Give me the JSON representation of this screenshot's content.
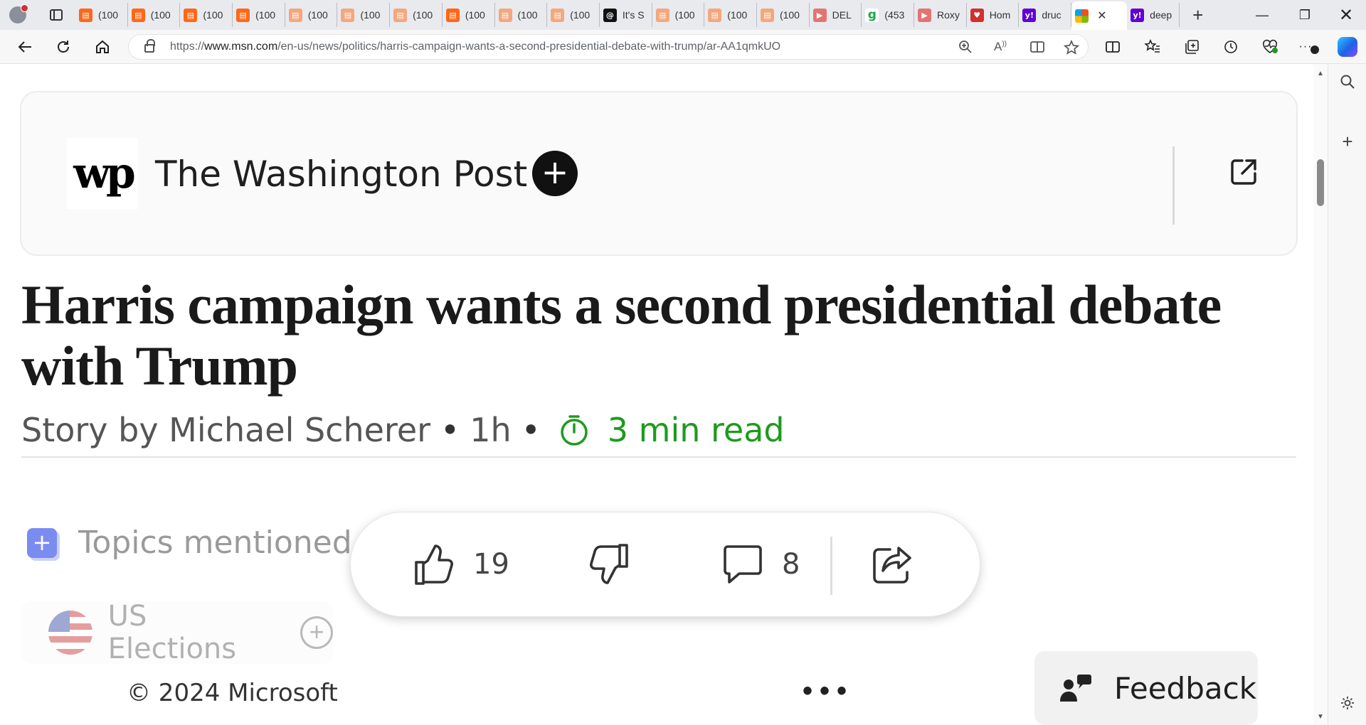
{
  "tabs": [
    {
      "label": "(100",
      "favicon": "substack-icon",
      "variant": "substack"
    },
    {
      "label": "(100",
      "favicon": "substack-icon",
      "variant": "substack"
    },
    {
      "label": "(100",
      "favicon": "substack-icon",
      "variant": "substack"
    },
    {
      "label": "(100",
      "favicon": "substack-icon",
      "variant": "substack"
    },
    {
      "label": "(100",
      "favicon": "substack-icon",
      "variant": "substack-faded"
    },
    {
      "label": "(100",
      "favicon": "substack-icon",
      "variant": "substack-faded"
    },
    {
      "label": "(100",
      "favicon": "substack-icon",
      "variant": "substack-faded"
    },
    {
      "label": "(100",
      "favicon": "substack-icon",
      "variant": "substack"
    },
    {
      "label": "(100",
      "favicon": "substack-icon",
      "variant": "substack-faded"
    },
    {
      "label": "(100",
      "favicon": "substack-icon",
      "variant": "substack-faded"
    },
    {
      "label": "It's S",
      "favicon": "threads-icon",
      "variant": "threads"
    },
    {
      "label": "(100",
      "favicon": "substack-icon",
      "variant": "substack-faded"
    },
    {
      "label": "(100",
      "favicon": "substack-icon",
      "variant": "substack-faded"
    },
    {
      "label": "(100",
      "favicon": "substack-icon",
      "variant": "substack-faded"
    },
    {
      "label": "DEL",
      "favicon": "youtube-icon",
      "variant": "youtube"
    },
    {
      "label": "(453",
      "favicon": "g-icon",
      "variant": "g"
    },
    {
      "label": "Roxy",
      "favicon": "youtube-icon",
      "variant": "youtube"
    },
    {
      "label": "Hom",
      "favicon": "red-app-icon",
      "variant": "red"
    },
    {
      "label": "druc",
      "favicon": "yahoo-icon",
      "variant": "yahoo"
    },
    {
      "label": "",
      "favicon": "microsoft-icon",
      "variant": "ms",
      "active": true
    },
    {
      "label": "deep",
      "favicon": "yahoo-icon",
      "variant": "yahoo"
    }
  ],
  "address_bar": {
    "url_prefix": "https://",
    "url_host": "www.msn.com",
    "url_path": "/en-us/news/politics/harris-campaign-wants-a-second-presidential-debate-with-trump/ar-AA1qmkUO"
  },
  "publisher": {
    "logo_text": "wp",
    "name": "The Washington Post",
    "follow_symbol": "+"
  },
  "article": {
    "headline": "Harris campaign wants a second presidential debate with Trump",
    "byline": "Story by Michael Scherer",
    "age": "1h",
    "separator": "•",
    "read_time": "3 min read"
  },
  "topics": {
    "label": "Topics mentioned in this article",
    "chip_label": "US Elections",
    "chip_add": "+"
  },
  "actions": {
    "likes": "19",
    "comments": "8"
  },
  "footer": {
    "copyright": "© 2024 Microsoft",
    "more": "•••",
    "feedback": "Feedback"
  },
  "colors": {
    "accent_green": "#1d9b1d",
    "substack": "#ff6719",
    "topic_icon": "#7b8cf0"
  }
}
